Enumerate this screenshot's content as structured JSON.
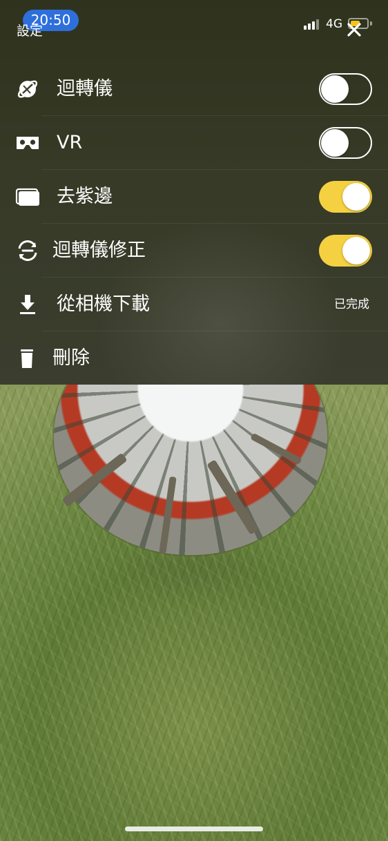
{
  "status_bar": {
    "time": "20:50",
    "network": "4G",
    "battery_color": "#f5c518"
  },
  "panel": {
    "title": "設定",
    "close_icon": "close-x-icon"
  },
  "settings": {
    "items": [
      {
        "label": "迴轉儀",
        "icon": "gyroscope-icon",
        "control": "toggle",
        "enabled": false
      },
      {
        "label": "VR",
        "icon": "vr-headset-icon",
        "control": "toggle",
        "enabled": false
      },
      {
        "label": "去紫邊",
        "icon": "purple-fringe-icon",
        "control": "toggle",
        "enabled": true
      },
      {
        "label": "迴轉儀修正",
        "icon": "gyro-calibration-icon",
        "control": "toggle",
        "enabled": true
      },
      {
        "label": "從相機下載",
        "icon": "download-icon",
        "control": "status",
        "status": "已完成"
      },
      {
        "label": "刪除",
        "icon": "trash-icon",
        "control": "none"
      }
    ]
  },
  "colors": {
    "toggle_on": "#f5d142",
    "time_pill": "#2e6fdc"
  }
}
